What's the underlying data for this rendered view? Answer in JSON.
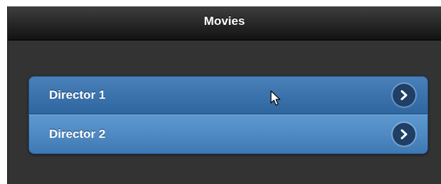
{
  "header": {
    "title": "Movies"
  },
  "list": {
    "items": [
      {
        "label": "Director 1",
        "icon": "chevron-right-icon"
      },
      {
        "label": "Director 2",
        "icon": "chevron-right-icon"
      }
    ]
  },
  "colors": {
    "header_bg": "#1e1e1e",
    "page_bg": "#333333",
    "item_blue": "#3b73ad",
    "item_blue_light": "#4f8ac3",
    "arrow_bg": "#1f3f66"
  }
}
